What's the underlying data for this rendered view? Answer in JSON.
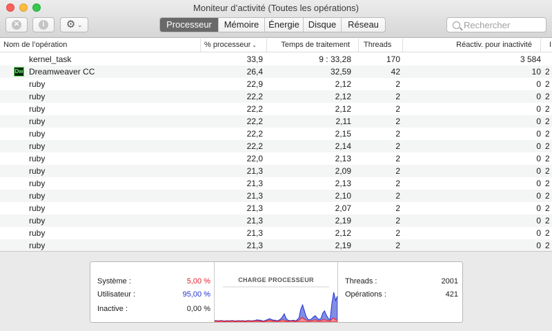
{
  "window": {
    "title": "Moniteur d’activité (Toutes les opérations)"
  },
  "toolbar": {
    "stop_glyph": "✕",
    "info_glyph": "i",
    "gear_glyph": "⚙",
    "chevron_glyph": "⌄",
    "tabs": [
      "Processeur",
      "Mémoire",
      "Énergie",
      "Disque",
      "Réseau"
    ],
    "active_tab": "Processeur",
    "search_placeholder": "Rechercher"
  },
  "table": {
    "headers": {
      "name": "Nom de l’opération",
      "cpu": "% processeur",
      "time": "Temps de traitement",
      "threads": "Threads",
      "wake": "Réactiv. pour inactivité",
      "pid": "I"
    },
    "sort_glyph": "⌄",
    "rows": [
      {
        "name": "kernel_task",
        "cpu": "33,9",
        "time": "9 : 33,28",
        "threads": "170",
        "wake": "3 584",
        "pid": ""
      },
      {
        "name": "Dreamweaver CC",
        "icon": "Dw",
        "cpu": "26,4",
        "time": "32,59",
        "threads": "42",
        "wake": "10",
        "pid": "2"
      },
      {
        "name": "ruby",
        "cpu": "22,9",
        "time": "2,12",
        "threads": "2",
        "wake": "0",
        "pid": "2"
      },
      {
        "name": "ruby",
        "cpu": "22,2",
        "time": "2,12",
        "threads": "2",
        "wake": "0",
        "pid": "2"
      },
      {
        "name": "ruby",
        "cpu": "22,2",
        "time": "2,12",
        "threads": "2",
        "wake": "0",
        "pid": "2"
      },
      {
        "name": "ruby",
        "cpu": "22,2",
        "time": "2,11",
        "threads": "2",
        "wake": "0",
        "pid": "2"
      },
      {
        "name": "ruby",
        "cpu": "22,2",
        "time": "2,15",
        "threads": "2",
        "wake": "0",
        "pid": "2"
      },
      {
        "name": "ruby",
        "cpu": "22,2",
        "time": "2,14",
        "threads": "2",
        "wake": "0",
        "pid": "2"
      },
      {
        "name": "ruby",
        "cpu": "22,0",
        "time": "2,13",
        "threads": "2",
        "wake": "0",
        "pid": "2"
      },
      {
        "name": "ruby",
        "cpu": "21,3",
        "time": "2,09",
        "threads": "2",
        "wake": "0",
        "pid": "2"
      },
      {
        "name": "ruby",
        "cpu": "21,3",
        "time": "2,13",
        "threads": "2",
        "wake": "0",
        "pid": "2"
      },
      {
        "name": "ruby",
        "cpu": "21,3",
        "time": "2,10",
        "threads": "2",
        "wake": "0",
        "pid": "2"
      },
      {
        "name": "ruby",
        "cpu": "21,3",
        "time": "2,07",
        "threads": "2",
        "wake": "0",
        "pid": "2"
      },
      {
        "name": "ruby",
        "cpu": "21,3",
        "time": "2,19",
        "threads": "2",
        "wake": "0",
        "pid": "2"
      },
      {
        "name": "ruby",
        "cpu": "21,3",
        "time": "2,12",
        "threads": "2",
        "wake": "0",
        "pid": "2"
      },
      {
        "name": "ruby",
        "cpu": "21,3",
        "time": "2,19",
        "threads": "2",
        "wake": "0",
        "pid": "2"
      }
    ]
  },
  "summary": {
    "system_label": "Système :",
    "system_value": "5,00 %",
    "user_label": "Utilisateur :",
    "user_value": "95,00 %",
    "idle_label": "Inactive :",
    "idle_value": "0,00 %",
    "graph_title": "CHARGE PROCESSEUR",
    "threads_label": "Threads :",
    "threads_value": "2001",
    "processes_label": "Opérations :",
    "processes_value": "421"
  },
  "colors": {
    "system": "#e0202b",
    "user": "#2230d0",
    "user_fill": "#7f8ee6",
    "system_fill": "#f08a96",
    "active_tab_bg": "#696969"
  },
  "cpu_history": {
    "system": [
      3,
      3,
      2,
      3,
      3,
      2,
      2,
      3,
      2,
      3,
      3,
      2,
      2,
      3,
      2,
      3,
      2,
      2,
      3,
      3,
      2,
      3,
      3,
      4,
      3,
      3,
      2,
      2,
      3,
      4,
      5,
      4,
      3,
      3,
      2,
      3,
      4,
      6,
      5,
      3,
      2,
      3,
      3,
      3,
      2,
      3,
      4,
      10,
      12,
      8,
      5,
      3,
      3,
      4,
      5,
      6,
      4,
      3,
      4,
      6,
      6,
      5,
      4,
      3,
      8,
      12,
      6,
      5
    ],
    "total": [
      4,
      4,
      3,
      4,
      4,
      3,
      3,
      4,
      3,
      4,
      4,
      3,
      3,
      4,
      3,
      4,
      3,
      3,
      4,
      4,
      3,
      4,
      4,
      6,
      5,
      5,
      3,
      3,
      5,
      7,
      9,
      7,
      5,
      5,
      3,
      5,
      8,
      14,
      22,
      10,
      5,
      4,
      4,
      5,
      3,
      6,
      11,
      34,
      46,
      30,
      14,
      7,
      6,
      9,
      14,
      17,
      10,
      7,
      9,
      24,
      30,
      18,
      10,
      6,
      50,
      80,
      58,
      70
    ]
  }
}
